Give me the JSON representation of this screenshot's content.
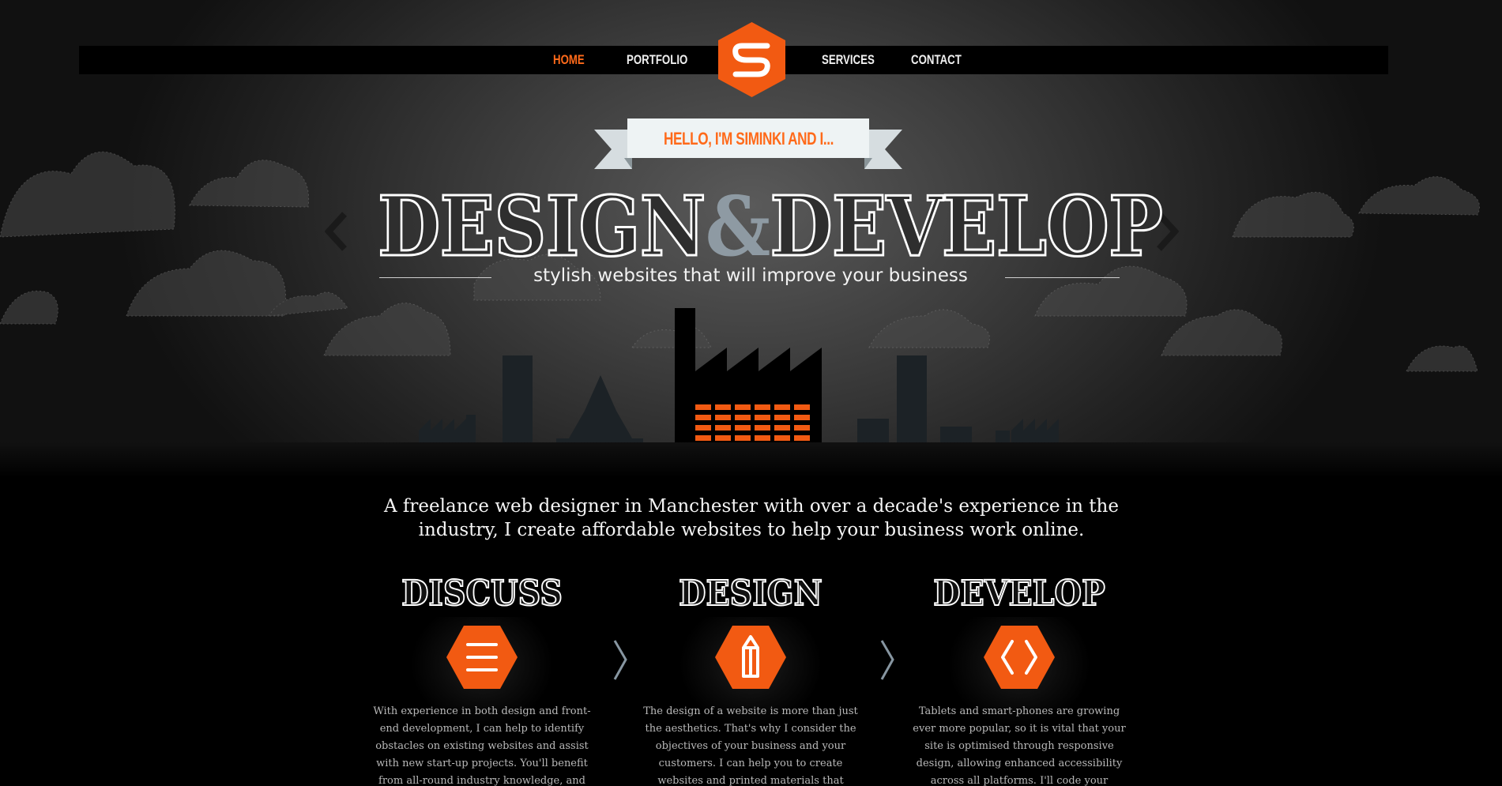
{
  "nav": {
    "items": [
      {
        "label": "HOME",
        "active": true
      },
      {
        "label": "PORTFOLIO",
        "active": false
      },
      {
        "label": "SERVICES",
        "active": false
      },
      {
        "label": "CONTACT",
        "active": false
      }
    ]
  },
  "hero": {
    "ribbon_text": "HELLO, I'M SIMINKI AND I...",
    "title_left": "DESIGN",
    "title_amp": "&",
    "title_right": "DEVELOP",
    "subtitle": "stylish websites that will improve your business"
  },
  "intro": {
    "line1": "A freelance web designer in Manchester with over a decade's experience in the",
    "line2": "industry, I create affordable websites to help your business work online."
  },
  "columns": [
    {
      "title": "DISCUSS",
      "icon": "menu-lines-icon",
      "text": "With experience in both design and front-end development, I can help to identify obstacles on existing websites and assist with new start-up projects. You'll benefit from all-round industry knowledge, and the"
    },
    {
      "title": "DESIGN",
      "icon": "pencil-icon",
      "text": "The design of a website is more than just the aesthetics. That's why I consider the objectives of your business and your customers. I can help you to create websites and printed materials that maintain"
    },
    {
      "title": "DEVELOP",
      "icon": "code-brackets-icon",
      "text": "Tablets and smart-phones are growing ever more popular, so it is vital that your site is optimised through responsive design, allowing enhanced accessibility across all platforms. I'll code your websites using the"
    }
  ],
  "colors": {
    "accent": "#ff6a1a",
    "background": "#000000",
    "ribbon": "#e8eef0",
    "amp": "#8e9aa3",
    "factory_windows": "#f25a12"
  }
}
